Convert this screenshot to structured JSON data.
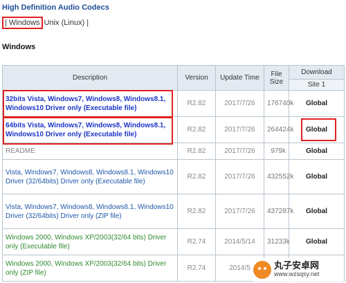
{
  "title": "High Definition Audio Codecs",
  "os_links": {
    "prefix": "|",
    "windows": "Windows",
    "rest": "Unix (Linux) |"
  },
  "section": "Windows",
  "table": {
    "headers": {
      "description": "Description",
      "version": "Version",
      "update_time": "Update Time",
      "file_size": "File Size",
      "download": "Download",
      "site": "Site 1"
    },
    "rows": [
      {
        "desc": "32bits Vista, Windows7, Windows8, Windows8.1, Windows10 Driver only (Executable file)",
        "style": "blue",
        "version": "R2.82",
        "date": "2017/7/26",
        "size": "176740k",
        "download": "Global"
      },
      {
        "desc": "64bits Vista, Windows7, Windows8, Windows8.1, Windows10 Driver only (Executable file)",
        "style": "blue",
        "version": "R2.82",
        "date": "2017/7/26",
        "size": "264424k",
        "download": "Global"
      },
      {
        "desc": "README",
        "style": "readme",
        "version": "R2.82",
        "date": "2017/7/26",
        "size": "979k",
        "download": "Global"
      },
      {
        "desc": "Vista, Windows7, Windows8, Windows8.1, Windows10 Driver (32/64bits) Driver only (Executable file)",
        "style": "norm",
        "version": "R2.82",
        "date": "2017/7/26",
        "size": "432552k",
        "download": "Global"
      },
      {
        "desc": "Vista, Windows7, Windows8, Windows8.1, Windows10 Driver (32/64bits) Driver only (ZIP file)",
        "style": "norm",
        "version": "R2.82",
        "date": "2017/7/26",
        "size": "437287k",
        "download": "Global"
      },
      {
        "desc": "Windows 2000, Windows XP/2003(32/64 bits) Driver only (Executable file)",
        "style": "green",
        "version": "R2.74",
        "date": "2014/5/14",
        "size": "31233k",
        "download": "Global"
      },
      {
        "desc": "Windows 2000, Windows XP/2003(32/64 bits) Driver only (ZIP file)",
        "style": "green",
        "version": "R2.74",
        "date": "2014/5",
        "size": "",
        "download": ""
      }
    ]
  },
  "watermark": {
    "brand": "丸子安卓网",
    "url": "www.wzsqsy.net"
  },
  "colors": {
    "title": "#1f4e96",
    "highlight": "#e02020",
    "header_bg": "#e3eaf2",
    "link_blue": "#1b35c8",
    "link_green": "#2f8a2f"
  }
}
